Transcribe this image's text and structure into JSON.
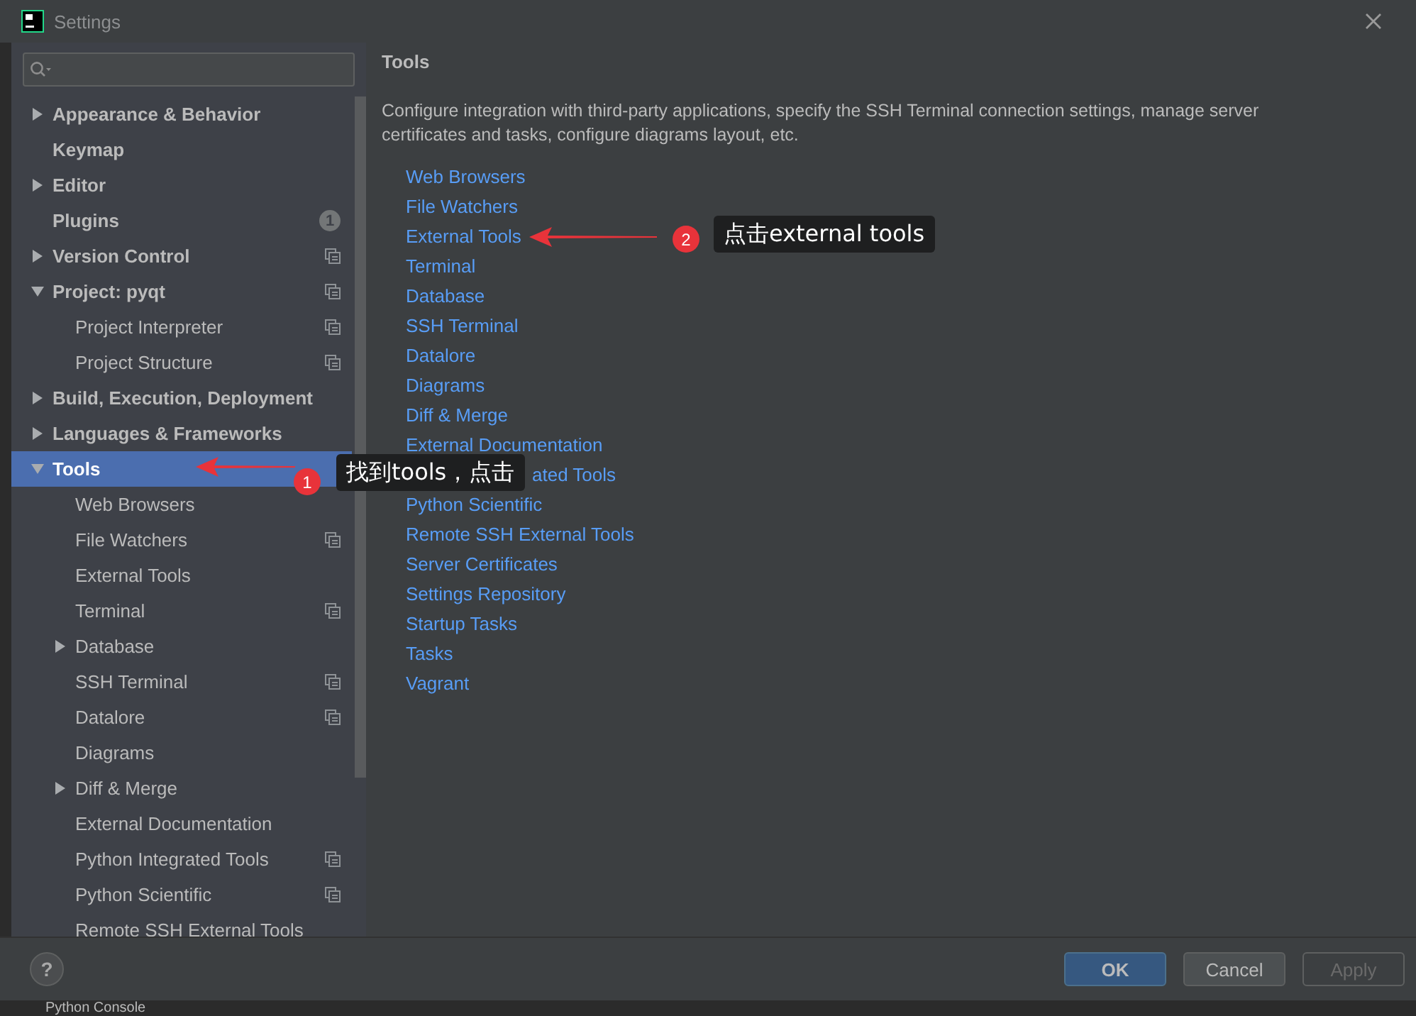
{
  "window": {
    "title": "Settings"
  },
  "sidebar": {
    "items": [
      {
        "label": "Appearance & Behavior",
        "expanded": false,
        "selected": false
      },
      {
        "label": "Keymap",
        "selected": false
      },
      {
        "label": "Editor",
        "expanded": false,
        "selected": false
      },
      {
        "label": "Plugins",
        "badge": "1",
        "selected": false
      },
      {
        "label": "Version Control",
        "expanded": false,
        "project_level": true,
        "selected": false
      },
      {
        "label": "Project: pyqt",
        "expanded": true,
        "project_level": true,
        "selected": false,
        "children": [
          {
            "label": "Project Interpreter",
            "project_level": true,
            "selected": false
          },
          {
            "label": "Project Structure",
            "project_level": true,
            "selected": false
          }
        ]
      },
      {
        "label": "Build, Execution, Deployment",
        "expanded": false,
        "selected": false
      },
      {
        "label": "Languages & Frameworks",
        "expanded": false,
        "selected": false
      },
      {
        "label": "Tools",
        "expanded": true,
        "selected": true,
        "children": [
          {
            "label": "Web Browsers",
            "selected": false
          },
          {
            "label": "File Watchers",
            "project_level": true,
            "selected": false
          },
          {
            "label": "External Tools",
            "selected": false
          },
          {
            "label": "Terminal",
            "project_level": true,
            "selected": false
          },
          {
            "label": "Database",
            "expanded": false,
            "selected": false
          },
          {
            "label": "SSH Terminal",
            "project_level": true,
            "selected": false
          },
          {
            "label": "Datalore",
            "project_level": true,
            "selected": false
          },
          {
            "label": "Diagrams",
            "selected": false
          },
          {
            "label": "Diff & Merge",
            "expanded": false,
            "selected": false
          },
          {
            "label": "External Documentation",
            "selected": false
          },
          {
            "label": "Python Integrated Tools",
            "project_level": true,
            "selected": false
          },
          {
            "label": "Python Scientific",
            "project_level": true,
            "selected": false
          },
          {
            "label": "Remote SSH External Tools",
            "selected": false
          }
        ]
      }
    ]
  },
  "content": {
    "title": "Tools",
    "description": "Configure integration with third-party applications, specify the SSH Terminal connection settings, manage server certificates and tasks, configure diagrams layout, etc.",
    "links": [
      {
        "label": "Web Browsers"
      },
      {
        "label": "File Watchers"
      },
      {
        "label": "External Tools"
      },
      {
        "label": "Terminal"
      },
      {
        "label": "Database"
      },
      {
        "label": "SSH Terminal"
      },
      {
        "label": "Datalore"
      },
      {
        "label": "Diagrams"
      },
      {
        "label": "Diff & Merge"
      },
      {
        "label": "External Documentation"
      },
      {
        "label": "ated Tools",
        "hidden_by_tooltip": true
      },
      {
        "label": "Python Scientific"
      },
      {
        "label": "Remote SSH External Tools"
      },
      {
        "label": "Server Certificates"
      },
      {
        "label": "Settings Repository"
      },
      {
        "label": "Startup Tasks"
      },
      {
        "label": "Tasks"
      },
      {
        "label": "Vagrant"
      }
    ]
  },
  "help": "?",
  "buttons": [
    {
      "label": "OK",
      "kind": "primary",
      "disabled": false
    },
    {
      "label": "Cancel",
      "kind": "normal",
      "disabled": false
    },
    {
      "label": "Apply",
      "kind": "normal",
      "disabled": true
    }
  ],
  "annotations": [
    {
      "number": "1",
      "text": "找到tools，点击"
    },
    {
      "number": "2",
      "text": "点击external tools"
    }
  ],
  "background_panel": {
    "label": "Python Console"
  }
}
